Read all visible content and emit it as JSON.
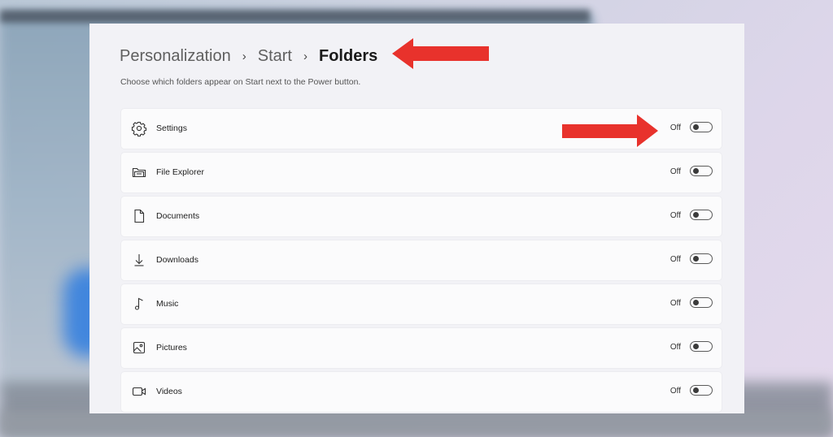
{
  "breadcrumb": {
    "items": [
      "Personalization",
      "Start",
      "Folders"
    ],
    "separator": "›"
  },
  "subtitle": "Choose which folders appear on Start next to the Power button.",
  "folders": [
    {
      "label": "Settings",
      "state": "Off",
      "icon": "gear-icon"
    },
    {
      "label": "File Explorer",
      "state": "Off",
      "icon": "folder-icon"
    },
    {
      "label": "Documents",
      "state": "Off",
      "icon": "document-icon"
    },
    {
      "label": "Downloads",
      "state": "Off",
      "icon": "download-icon"
    },
    {
      "label": "Music",
      "state": "Off",
      "icon": "music-note-icon"
    },
    {
      "label": "Pictures",
      "state": "Off",
      "icon": "picture-icon"
    },
    {
      "label": "Videos",
      "state": "Off",
      "icon": "video-camera-icon"
    }
  ],
  "colors": {
    "annotation_arrow": "#e8322c",
    "panel_background": "#f2f2f6"
  }
}
